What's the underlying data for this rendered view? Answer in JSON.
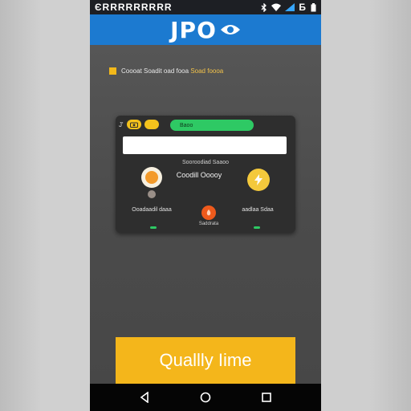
{
  "status_bar": {
    "left_text": "ЄRRRRRRRRR",
    "right_text": "Ƃ",
    "icons": [
      "bluetooth-icon",
      "wifi-icon",
      "signal-icon",
      "battery-icon"
    ]
  },
  "app_bar": {
    "title": "JPO",
    "logo_icon": "eye-icon"
  },
  "notice": {
    "text_main": "Coooat Soadit oad fooa",
    "text_highlight": "Soad foooa"
  },
  "card": {
    "top_mini": "J'",
    "green_pill": "Baoo",
    "input_value": "",
    "input_placeholder": "",
    "subtitle": "Sooroodiad Saaoo",
    "center_label": "Coodill Ooooy",
    "label_left": "Ooadaadil daaa",
    "label_under_button": "Saddrata",
    "label_right": "aadlaa Sdaa"
  },
  "cta": {
    "label": "Quallly Iime"
  },
  "nav": {
    "back": "back-icon",
    "home": "home-icon",
    "recents": "recents-icon"
  },
  "colors": {
    "appbar": "#1c7ad0",
    "accent_yellow": "#f4b61b",
    "accent_green": "#2ec964",
    "accent_orange": "#ee5a1c"
  }
}
